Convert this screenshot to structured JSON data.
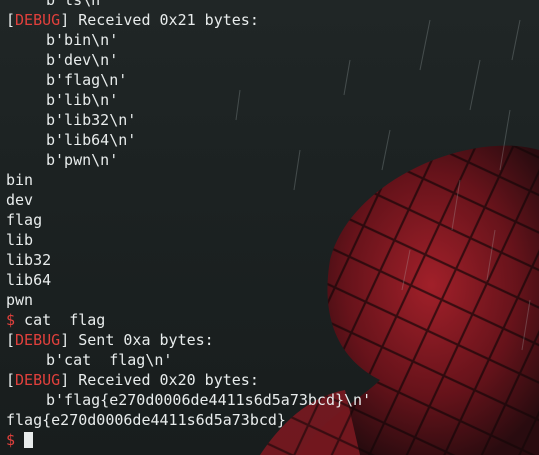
{
  "terminal": {
    "lines": [
      {
        "kind": "indent",
        "text": "b'ls\\n'"
      },
      {
        "kind": "debug",
        "tag": "DEBUG",
        "text": " Received 0x21 bytes:"
      },
      {
        "kind": "indent",
        "text": "b'bin\\n'"
      },
      {
        "kind": "indent",
        "text": "b'dev\\n'"
      },
      {
        "kind": "indent",
        "text": "b'flag\\n'"
      },
      {
        "kind": "indent",
        "text": "b'lib\\n'"
      },
      {
        "kind": "indent",
        "text": "b'lib32\\n'"
      },
      {
        "kind": "indent",
        "text": "b'lib64\\n'"
      },
      {
        "kind": "indent",
        "text": "b'pwn\\n'"
      },
      {
        "kind": "plain",
        "text": "bin"
      },
      {
        "kind": "plain",
        "text": "dev"
      },
      {
        "kind": "plain",
        "text": "flag"
      },
      {
        "kind": "plain",
        "text": "lib"
      },
      {
        "kind": "plain",
        "text": "lib32"
      },
      {
        "kind": "plain",
        "text": "lib64"
      },
      {
        "kind": "plain",
        "text": "pwn"
      },
      {
        "kind": "prompt",
        "symbol": "$",
        "text": " cat  flag"
      },
      {
        "kind": "debug",
        "tag": "DEBUG",
        "text": " Sent 0xa bytes:"
      },
      {
        "kind": "indent",
        "text": "b'cat  flag\\n'"
      },
      {
        "kind": "debug",
        "tag": "DEBUG",
        "text": " Received 0x20 bytes:"
      },
      {
        "kind": "indent",
        "text": "b'flag{e270d0006de4411s6d5a73bcd}\\n'"
      },
      {
        "kind": "plain",
        "text": "flag{e270d0006de4411s6d5a73bcd}"
      },
      {
        "kind": "cursor-prompt",
        "symbol": "$",
        "text": ""
      }
    ]
  },
  "colors": {
    "background": "#1c2222",
    "text": "#e8ecec",
    "debug_tag": "#e0403c",
    "prompt_symbol": "#e0403c"
  }
}
